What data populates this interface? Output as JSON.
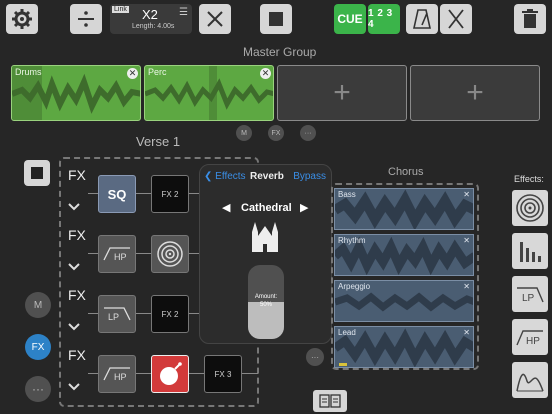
{
  "toolbar": {
    "link_label": "Link",
    "multiplier": "X2",
    "length": "Length: 4.00s",
    "cue_label": "CUE",
    "count_label": "1 2 3 4"
  },
  "master": {
    "title": "Master Group",
    "loops": [
      {
        "label": "Drums"
      },
      {
        "label": "Perc"
      }
    ],
    "mute": "M",
    "fx": "FX",
    "more": "···"
  },
  "verse": {
    "title": "Verse 1",
    "fx_rows": [
      {
        "label": "FX",
        "slot1": "SQ",
        "slot2": "FX 2"
      },
      {
        "label": "FX",
        "slot1": "HP",
        "slot2": ""
      },
      {
        "label": "FX",
        "slot1": "LP",
        "slot2": "FX 2"
      },
      {
        "label": "FX",
        "slot1": "HP",
        "slot3": "FX 3"
      }
    ],
    "mute": "M",
    "fx": "FX",
    "more": "···"
  },
  "popup": {
    "back_label": "Effects",
    "title": "Reverb",
    "bypass_label": "Bypass",
    "preset": "Cathedral",
    "amount_label": "Amount:",
    "amount_value": "50%",
    "amount": 0.5
  },
  "chorus": {
    "title": "Chorus",
    "tracks": [
      {
        "label": "Bass"
      },
      {
        "label": "Rhythm"
      },
      {
        "label": "Arpeggio"
      },
      {
        "label": "Lead"
      }
    ]
  },
  "effects_panel": {
    "title": "Effects:",
    "items": [
      "reverb",
      "eq",
      "LP",
      "HP",
      "envelope"
    ]
  }
}
